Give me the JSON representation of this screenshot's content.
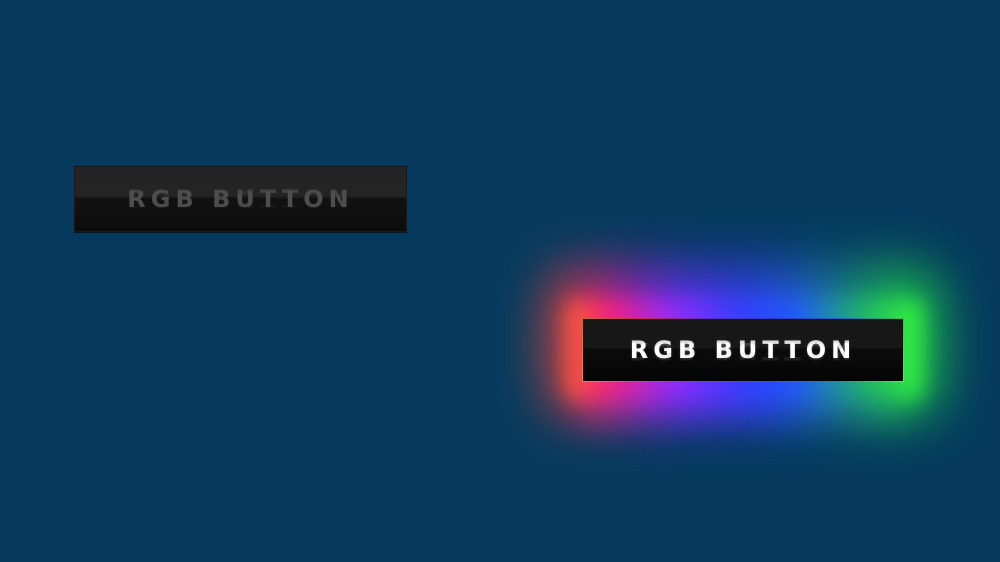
{
  "buttons": {
    "idle": {
      "label": "RGB BUTTON",
      "state": "idle"
    },
    "active": {
      "label": "RGB BUTTON",
      "state": "hover"
    }
  },
  "colors": {
    "background": "#053a5e",
    "button_face": "#111111",
    "idle_text": "#4a4a4a",
    "active_text": "#ffffff",
    "glow_gradient": [
      "#ff5a1f",
      "#e2197a",
      "#7a2cff",
      "#3b3bff",
      "#2a5cff",
      "#1aa36a",
      "#22ff3a"
    ]
  }
}
